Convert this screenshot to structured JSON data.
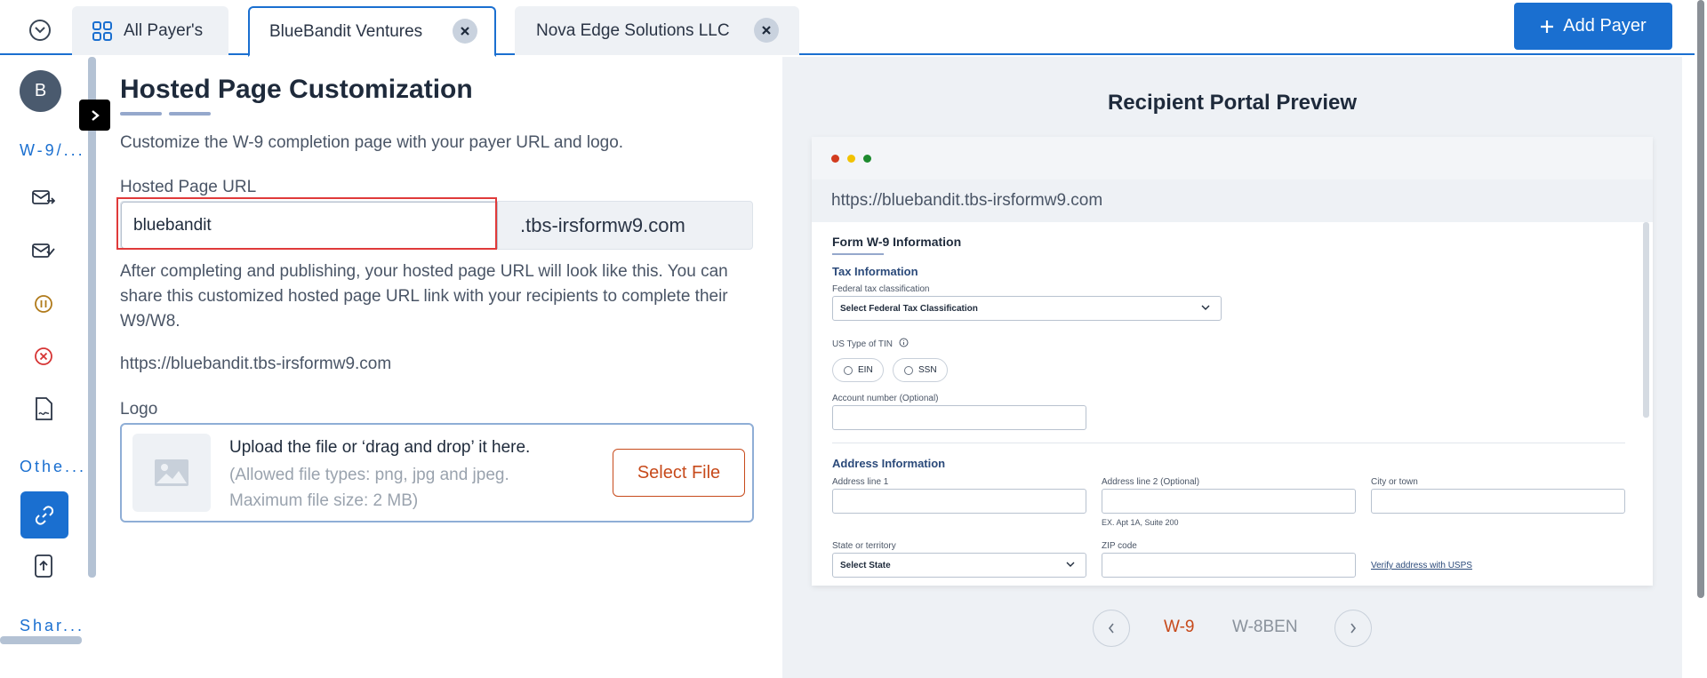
{
  "tabs": {
    "all_payers": "All Payer's",
    "active": "BlueBandit Ventures",
    "other": "Nova Edge Solutions LLC"
  },
  "header": {
    "add_payer": "Add Payer"
  },
  "sidebar": {
    "avatar_letter": "B",
    "section_w9": "W-9/...",
    "section_other": "Othe...",
    "section_share": "Shar..."
  },
  "main": {
    "title": "Hosted Page Customization",
    "description": "Customize the W-9 completion page with your payer URL and logo.",
    "url_label": "Hosted Page URL",
    "url_value": "bluebandit",
    "url_suffix": ".tbs-irsformw9.com",
    "after_text": "After completing and publishing, your hosted page URL will look like this. You can share this customized hosted page URL link with your recipients to complete their W9/W8.",
    "url_result": "https://bluebandit.tbs-irsformw9.com",
    "logo_label": "Logo",
    "upload_title": "Upload the file or ‘drag and drop’ it here.",
    "upload_types": "(Allowed file types: png, jpg and jpeg.",
    "upload_size": "Maximum file size: 2 MB)",
    "select_file": "Select File"
  },
  "preview": {
    "title": "Recipient Portal Preview",
    "browser_url": "https://bluebandit.tbs-irsformw9.com",
    "form": {
      "title": "Form W-9 Information",
      "tax_section": "Tax Information",
      "federal_label": "Federal tax classification",
      "federal_placeholder": "Select Federal Tax Classification",
      "tin_label": "US Type of TIN",
      "ein": "EIN",
      "ssn": "SSN",
      "account_label": "Account number (Optional)",
      "address_section": "Address Information",
      "addr1_label": "Address line 1",
      "addr2_label": "Address line 2 (Optional)",
      "addr2_hint": "EX. Apt 1A, Suite 200",
      "city_label": "City or town",
      "state_label": "State or territory",
      "state_placeholder": "Select State",
      "zip_label": "ZIP code",
      "verify_link": "Verify address with USPS"
    },
    "pager": {
      "w9": "W-9",
      "w8": "W-8BEN"
    }
  },
  "colors": {
    "primary": "#1a6fd0",
    "accent_orange": "#c74a1b",
    "highlight_red": "#e03a3a"
  }
}
